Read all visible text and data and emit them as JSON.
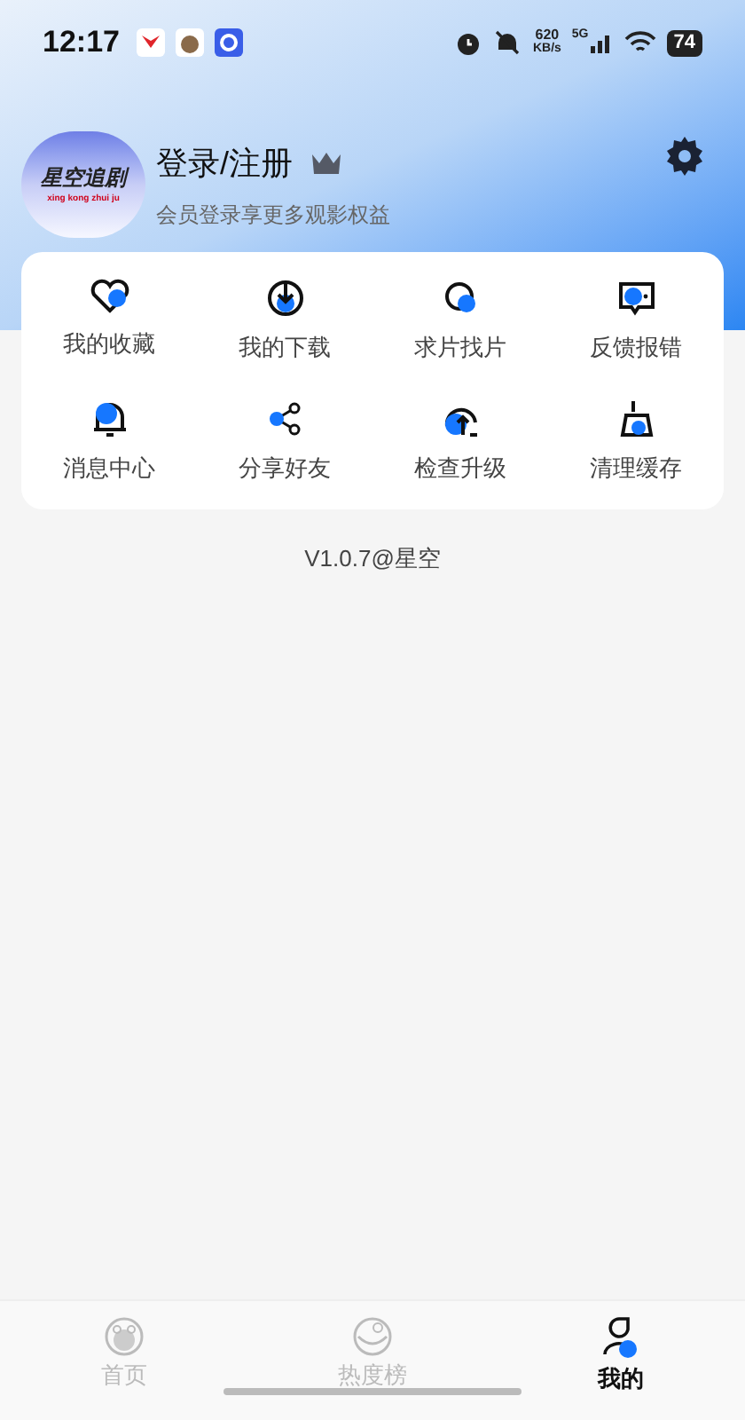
{
  "status_bar": {
    "time": "12:17",
    "speed": "620",
    "speed_unit": "KB/s",
    "network": "5G",
    "battery": "74"
  },
  "profile": {
    "logo_title": "星空追剧",
    "logo_subtitle": "xing kong zhui ju",
    "name": "登录/注册",
    "subtitle": "会员登录享更多观影权益"
  },
  "menu": [
    {
      "kind": "heart",
      "label": "我的收藏"
    },
    {
      "kind": "download",
      "label": "我的下载"
    },
    {
      "kind": "search",
      "label": "求片找片"
    },
    {
      "kind": "feedback",
      "label": "反馈报错"
    },
    {
      "kind": "bell",
      "label": "消息中心"
    },
    {
      "kind": "share",
      "label": "分享好友"
    },
    {
      "kind": "upgrade",
      "label": "检查升级"
    },
    {
      "kind": "clean",
      "label": "清理缓存"
    }
  ],
  "version": "V1.0.7@星空",
  "tabs": [
    {
      "kind": "home",
      "label": "首页",
      "selected": false
    },
    {
      "kind": "hot",
      "label": "热度榜",
      "selected": false
    },
    {
      "kind": "me",
      "label": "我的",
      "selected": true
    }
  ]
}
